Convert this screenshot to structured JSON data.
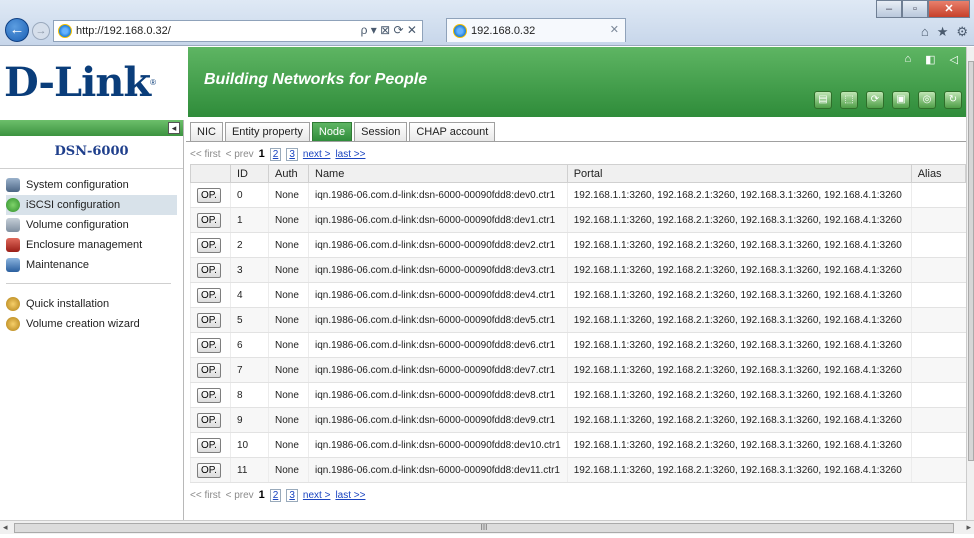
{
  "browser": {
    "url": "http://192.168.0.32/",
    "address_tools": "ρ ▾ ⊠ ⟳ ✕",
    "tab_title": "192.168.0.32",
    "tab_close": "✕",
    "back": "←",
    "forward": "→",
    "min": "–",
    "max": "▫",
    "close": "✕",
    "home": "⌂",
    "star": "★",
    "gear": "⚙"
  },
  "header": {
    "logo": "D-Link",
    "logo_mark": "®",
    "slogan": "Building Networks for People",
    "tools": [
      "⌂",
      "◧",
      "◁"
    ],
    "icons": [
      "▤",
      "⬚",
      "⟳",
      "▣",
      "◎",
      "↻"
    ]
  },
  "sidebar": {
    "collapse": "◂",
    "model": "DSN-6000",
    "items": [
      {
        "label": "System configuration"
      },
      {
        "label": "iSCSI configuration"
      },
      {
        "label": "Volume configuration"
      },
      {
        "label": "Enclosure management"
      },
      {
        "label": "Maintenance"
      }
    ],
    "extra_items": [
      {
        "label": "Quick installation"
      },
      {
        "label": "Volume creation wizard"
      }
    ]
  },
  "tabs": [
    {
      "label": "NIC"
    },
    {
      "label": "Entity property"
    },
    {
      "label": "Node"
    },
    {
      "label": "Session"
    },
    {
      "label": "CHAP account"
    }
  ],
  "pager": {
    "first": "<< first",
    "prev": "< prev",
    "current": "1",
    "page2": "2",
    "page3": "3",
    "next": "next >",
    "last": "last >>"
  },
  "table": {
    "headers": [
      "",
      "ID",
      "Auth",
      "Name",
      "Portal",
      "Alias"
    ],
    "op_label": "OP.",
    "rows": [
      {
        "id": "0",
        "auth": "None",
        "name": "iqn.1986-06.com.d-link:dsn-6000-00090fdd8:dev0.ctr1",
        "portal": "192.168.1.1:3260, 192.168.2.1:3260, 192.168.3.1:3260, 192.168.4.1:3260",
        "alias": ""
      },
      {
        "id": "1",
        "auth": "None",
        "name": "iqn.1986-06.com.d-link:dsn-6000-00090fdd8:dev1.ctr1",
        "portal": "192.168.1.1:3260, 192.168.2.1:3260, 192.168.3.1:3260, 192.168.4.1:3260",
        "alias": ""
      },
      {
        "id": "2",
        "auth": "None",
        "name": "iqn.1986-06.com.d-link:dsn-6000-00090fdd8:dev2.ctr1",
        "portal": "192.168.1.1:3260, 192.168.2.1:3260, 192.168.3.1:3260, 192.168.4.1:3260",
        "alias": ""
      },
      {
        "id": "3",
        "auth": "None",
        "name": "iqn.1986-06.com.d-link:dsn-6000-00090fdd8:dev3.ctr1",
        "portal": "192.168.1.1:3260, 192.168.2.1:3260, 192.168.3.1:3260, 192.168.4.1:3260",
        "alias": ""
      },
      {
        "id": "4",
        "auth": "None",
        "name": "iqn.1986-06.com.d-link:dsn-6000-00090fdd8:dev4.ctr1",
        "portal": "192.168.1.1:3260, 192.168.2.1:3260, 192.168.3.1:3260, 192.168.4.1:3260",
        "alias": ""
      },
      {
        "id": "5",
        "auth": "None",
        "name": "iqn.1986-06.com.d-link:dsn-6000-00090fdd8:dev5.ctr1",
        "portal": "192.168.1.1:3260, 192.168.2.1:3260, 192.168.3.1:3260, 192.168.4.1:3260",
        "alias": ""
      },
      {
        "id": "6",
        "auth": "None",
        "name": "iqn.1986-06.com.d-link:dsn-6000-00090fdd8:dev6.ctr1",
        "portal": "192.168.1.1:3260, 192.168.2.1:3260, 192.168.3.1:3260, 192.168.4.1:3260",
        "alias": ""
      },
      {
        "id": "7",
        "auth": "None",
        "name": "iqn.1986-06.com.d-link:dsn-6000-00090fdd8:dev7.ctr1",
        "portal": "192.168.1.1:3260, 192.168.2.1:3260, 192.168.3.1:3260, 192.168.4.1:3260",
        "alias": ""
      },
      {
        "id": "8",
        "auth": "None",
        "name": "iqn.1986-06.com.d-link:dsn-6000-00090fdd8:dev8.ctr1",
        "portal": "192.168.1.1:3260, 192.168.2.1:3260, 192.168.3.1:3260, 192.168.4.1:3260",
        "alias": ""
      },
      {
        "id": "9",
        "auth": "None",
        "name": "iqn.1986-06.com.d-link:dsn-6000-00090fdd8:dev9.ctr1",
        "portal": "192.168.1.1:3260, 192.168.2.1:3260, 192.168.3.1:3260, 192.168.4.1:3260",
        "alias": ""
      },
      {
        "id": "10",
        "auth": "None",
        "name": "iqn.1986-06.com.d-link:dsn-6000-00090fdd8:dev10.ctr1",
        "portal": "192.168.1.1:3260, 192.168.2.1:3260, 192.168.3.1:3260, 192.168.4.1:3260",
        "alias": ""
      },
      {
        "id": "11",
        "auth": "None",
        "name": "iqn.1986-06.com.d-link:dsn-6000-00090fdd8:dev11.ctr1",
        "portal": "192.168.1.1:3260, 192.168.2.1:3260, 192.168.3.1:3260, 192.168.4.1:3260",
        "alias": ""
      }
    ]
  },
  "scroll": {
    "left": "◂",
    "right": "▸",
    "grip": "III"
  },
  "colors": {
    "brand_green": "#2f8c3a",
    "logo_blue": "#0a3d7a",
    "link_blue": "#1a44c0"
  }
}
